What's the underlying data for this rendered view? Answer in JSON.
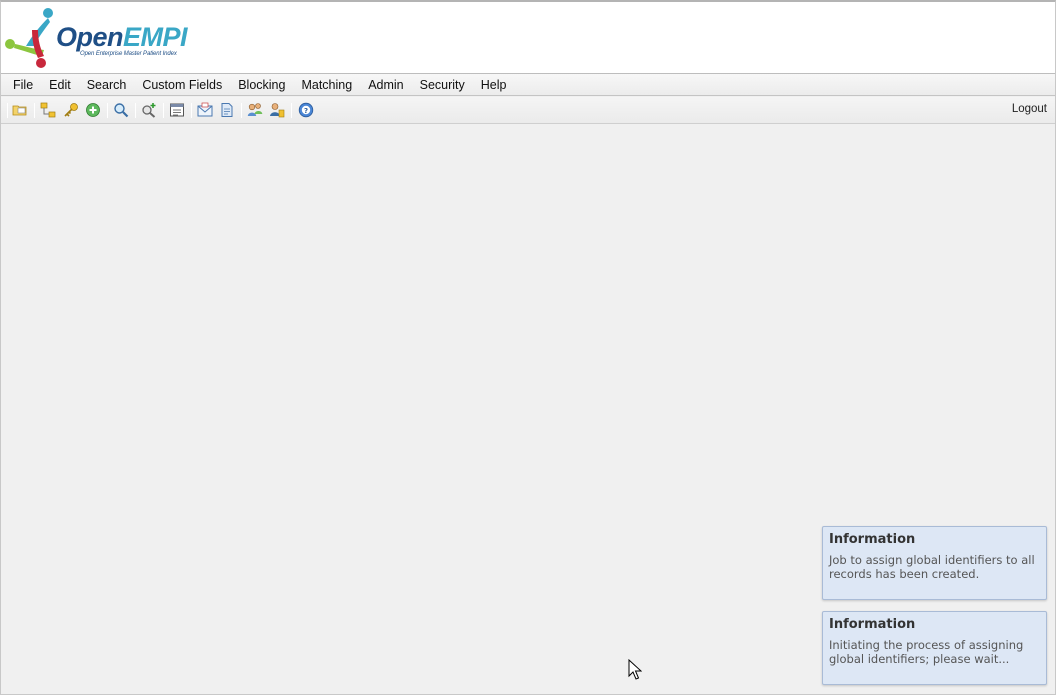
{
  "app": {
    "logo_word_1": "Open",
    "logo_word_2": "EMPI",
    "logo_tagline": "Open Enterprise Master Patient Index",
    "brand_colors": {
      "navy": "#1f4f86",
      "teal": "#3aa7c6",
      "green": "#8cc63f",
      "red": "#c8283c"
    }
  },
  "menu": [
    {
      "label": "File"
    },
    {
      "label": "Edit"
    },
    {
      "label": "Search"
    },
    {
      "label": "Custom Fields"
    },
    {
      "label": "Blocking"
    },
    {
      "label": "Matching"
    },
    {
      "label": "Admin"
    },
    {
      "label": "Security"
    },
    {
      "label": "Help"
    }
  ],
  "toolbar": {
    "icons": [
      "open-folder-icon",
      "tree-structure-icon",
      "key-icon",
      "add-icon",
      "search-icon",
      "search-add-icon",
      "report-icon",
      "mail-icon",
      "document-icon",
      "users-icon",
      "user-settings-icon",
      "help-icon"
    ],
    "logout_label": "Logout"
  },
  "notifications": [
    {
      "title": "Information",
      "message": "Job to assign global identifiers to all records has been created."
    },
    {
      "title": "Information",
      "message": "Initiating the process of assigning global identifiers; please wait..."
    }
  ]
}
